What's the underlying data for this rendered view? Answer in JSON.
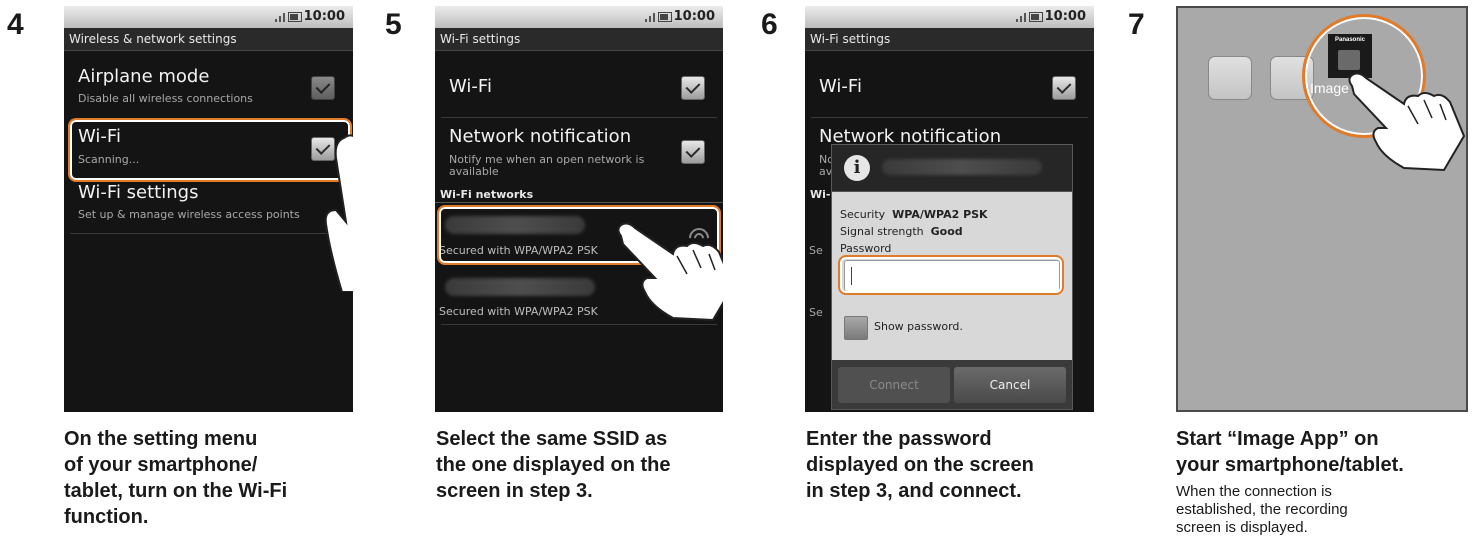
{
  "status_time": "10:00",
  "steps": [
    {
      "number": "4",
      "screen_title": "Wireless & network settings",
      "items": [
        {
          "title": "Airplane mode",
          "subtitle": "Disable all wireless connections"
        },
        {
          "title": "Wi-Fi",
          "subtitle": "Scanning..."
        },
        {
          "title": "Wi-Fi settings",
          "subtitle": "Set up & manage wireless access points"
        }
      ],
      "caption_lines": [
        "On the setting menu",
        "of your smartphone/",
        "tablet, turn on the Wi-Fi",
        "function."
      ]
    },
    {
      "number": "5",
      "screen_title": "Wi-Fi settings",
      "wifi_label": "Wi-Fi",
      "notification_title": "Network notification",
      "notification_sub_1": "Notify me when an open network is",
      "notification_sub_2": "available",
      "networks_header": "Wi-Fi networks",
      "networks": [
        {
          "security": "Secured with WPA/WPA2 PSK"
        },
        {
          "security": "Secured with WPA/WPA2 PSK"
        }
      ],
      "caption_lines": [
        "Select the same SSID as",
        "the one displayed on the",
        "screen in step 3."
      ]
    },
    {
      "number": "6",
      "screen_title": "Wi-Fi settings",
      "wifi_label": "Wi-Fi",
      "notification_title": "Network notification",
      "bg_sub_1": "No",
      "bg_sub_2": "av",
      "bg_header": "Wi-I",
      "bg_se_1": "Se",
      "bg_se_2": "Se",
      "dialog": {
        "security_label": "Security",
        "security_value": "WPA/WPA2 PSK",
        "strength_label": "Signal strength",
        "strength_value": "Good",
        "password_label": "Password",
        "show_password": "Show password.",
        "connect": "Connect",
        "cancel": "Cancel"
      },
      "caption_lines": [
        "Enter the password",
        "displayed on the screen",
        "in step 3, and connect."
      ]
    },
    {
      "number": "7",
      "app_brand": "Panasonic",
      "app_label": "Image App",
      "caption_lines": [
        "Start “Image App” on",
        "your smartphone/tablet."
      ],
      "subcaption_lines": [
        "When the connection is",
        "established, the recording",
        "screen is displayed."
      ]
    }
  ],
  "colors": {
    "highlight": "#e07b2a",
    "phone_bg": "#141414",
    "home_bg": "#a9a9a9"
  }
}
